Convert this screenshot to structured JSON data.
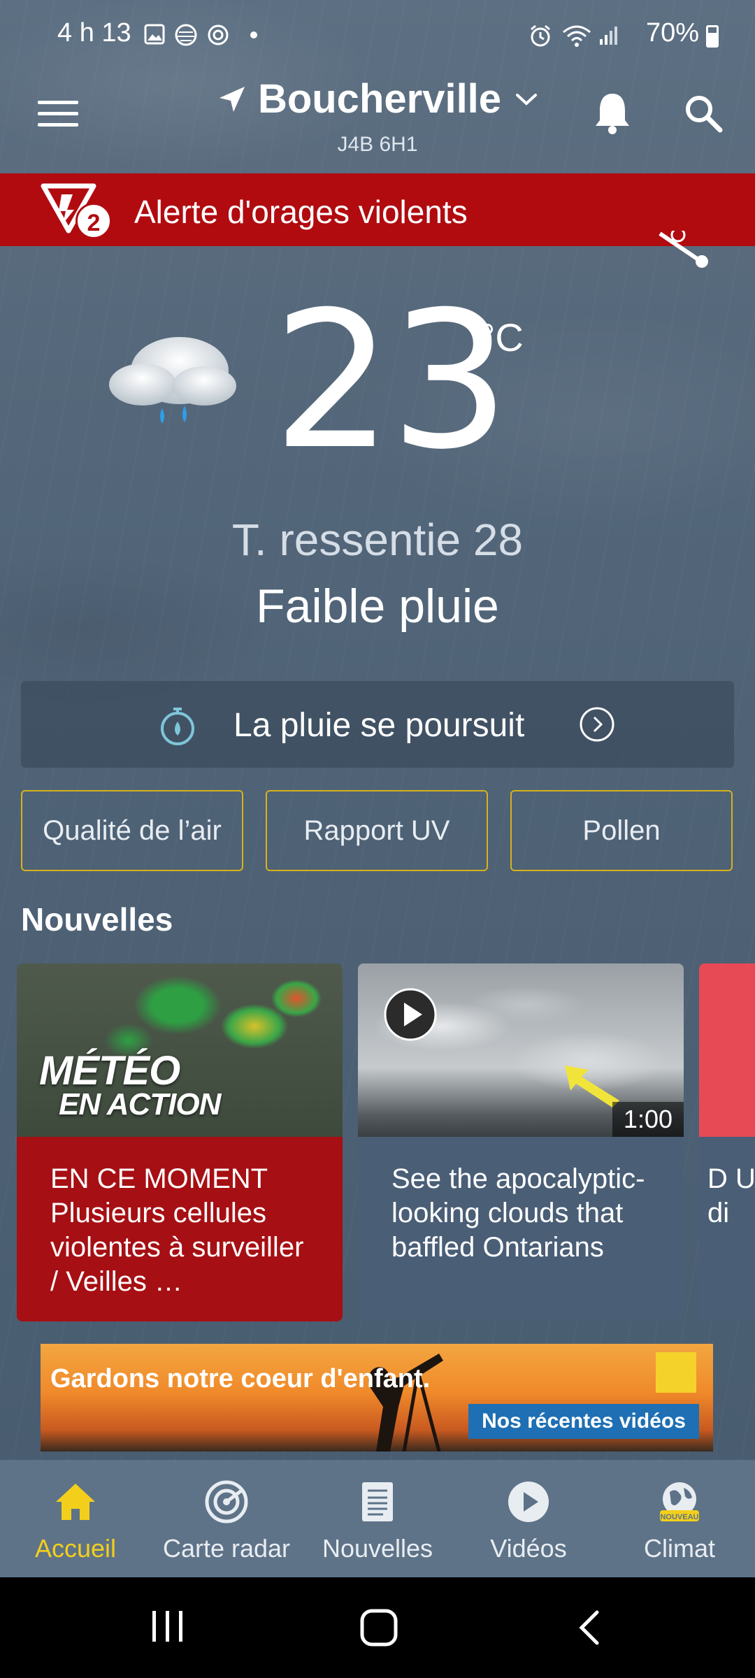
{
  "status_bar": {
    "time": "4 h 13",
    "battery": "70%",
    "icons": [
      "image-icon",
      "app-icon",
      "target-icon",
      "dot-icon",
      "alarm-icon",
      "wifi-icon",
      "signal-icon",
      "battery-icon"
    ]
  },
  "header": {
    "city": "Boucherville",
    "postal": "J4B 6H1",
    "icons": [
      "menu-icon",
      "location-arrow-icon",
      "chevron-down-icon",
      "bell-icon",
      "search-icon"
    ]
  },
  "alert": {
    "count": "2",
    "text": "Alerte d'orages violents"
  },
  "current": {
    "temperature": "23",
    "unit": "°C",
    "feels_like": "T. ressentie 28",
    "condition": "Faible pluie",
    "icon": "cloud-rain-icon"
  },
  "rain_banner": {
    "text": "La pluie se poursuit"
  },
  "chips": {
    "air": "Qualité de l’air",
    "uv": "Rapport UV",
    "pollen": "Pollen"
  },
  "news": {
    "title": "Nouvelles",
    "cards": [
      {
        "badge_line1": "MÉTÉO",
        "badge_line2": "EN ACTION",
        "text": "EN CE MOMENT Plusieurs cellules violentes à surveiller / Veilles …"
      },
      {
        "duration": "1:00",
        "text": "See the apocalyptic-looking clouds that baffled Ontarians"
      },
      {
        "text": "D U di"
      }
    ]
  },
  "ad": {
    "text": "Gardons notre coeur d'enfant.",
    "cta": "Nos récentes vidéos"
  },
  "bottom_nav": {
    "items": [
      {
        "label": "Accueil",
        "icon": "home-icon",
        "active": true
      },
      {
        "label": "Carte radar",
        "icon": "radar-icon"
      },
      {
        "label": "Nouvelles",
        "icon": "news-icon"
      },
      {
        "label": "Vidéos",
        "icon": "play-icon"
      },
      {
        "label": "Climat",
        "icon": "globe-icon",
        "badge": "NOUVEAU"
      }
    ]
  },
  "colors": {
    "alert_red": "#b10b10",
    "accent_yellow": "#f3cf1c",
    "chip_border": "#d6b21e",
    "nav_bg": "#5e7388"
  }
}
